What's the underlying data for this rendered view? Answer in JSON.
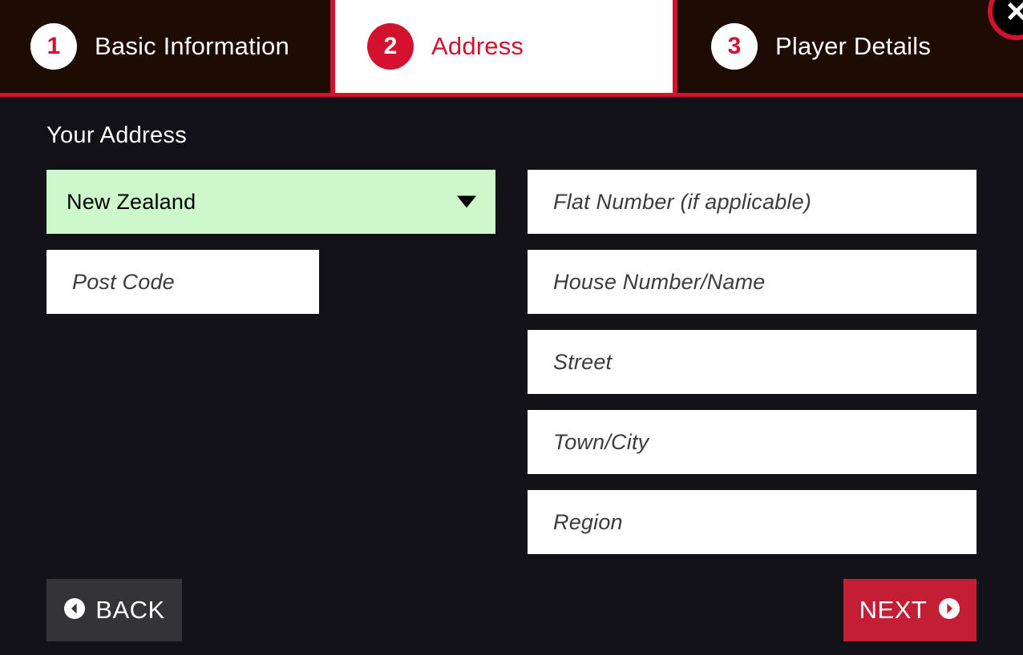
{
  "window": {
    "close_label": "close-icon"
  },
  "steps": [
    {
      "number": "1",
      "label": "Basic Information",
      "active": false
    },
    {
      "number": "2",
      "label": "Address",
      "active": true
    },
    {
      "number": "3",
      "label": "Player Details",
      "active": false
    }
  ],
  "section": {
    "title": "Your Address"
  },
  "fields": {
    "country": {
      "value": "New Zealand",
      "caret": "chevron-down-icon"
    },
    "post_code": {
      "placeholder": "Post Code",
      "value": ""
    },
    "flat_number": {
      "placeholder": "Flat Number (if applicable)",
      "value": ""
    },
    "house_number": {
      "placeholder": "House Number/Name",
      "value": ""
    },
    "street": {
      "placeholder": "Street",
      "value": ""
    },
    "town_city": {
      "placeholder": "Town/City",
      "value": ""
    },
    "region": {
      "placeholder": "Region",
      "value": ""
    }
  },
  "footer": {
    "back_label": "BACK",
    "next_label": "NEXT",
    "back_icon": "circle-chevron-left-icon",
    "next_icon": "circle-chevron-right-icon"
  },
  "colors": {
    "accent": "#d2122e",
    "next_button": "#c41e35",
    "back_button": "#333338",
    "tab_inactive_bg": "#1d0b04",
    "page_bg": "#121218",
    "select_bg": "#ccf8cc"
  }
}
